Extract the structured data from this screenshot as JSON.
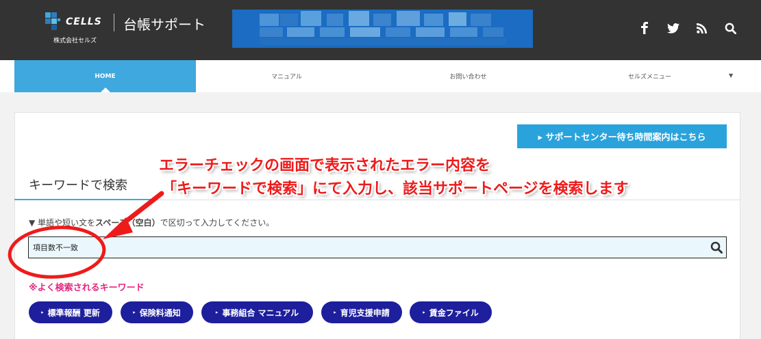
{
  "header": {
    "logo_text": "CELLS",
    "company_name": "株式会社セルズ",
    "site_title": "台帳サポート",
    "social": [
      {
        "icon": "facebook-icon"
      },
      {
        "icon": "twitter-icon"
      },
      {
        "icon": "rss-icon"
      },
      {
        "icon": "search-icon"
      }
    ]
  },
  "nav": {
    "items": [
      {
        "label": "HOME",
        "active": true
      },
      {
        "label": "マニュアル"
      },
      {
        "label": "お問い合わせ"
      },
      {
        "label": "セルズメニュー",
        "has_dropdown": true
      }
    ],
    "dropdown_glyph": "▼"
  },
  "support_button": {
    "label": "▸ サポートセンター待ち時間案内はこちら"
  },
  "search_section": {
    "title": "キーワードで検索",
    "hint_before": "▼ 単語や短い文を",
    "hint_bold": "スペース（空白）",
    "hint_after": "で区切って入力してください。",
    "input_value": "項目数不一致",
    "popular_label": "※よく検索されるキーワード",
    "tags": [
      "標準報酬 更新",
      "保険料通知",
      "事務組合 マニュアル",
      "育児支援申請",
      "賃金ファイル"
    ],
    "tag_glyph": "▸"
  },
  "annotation": {
    "line1": "エラーチェックの画面で表示されたエラー内容を",
    "line2": "「キーワードで検索」にて入力し、該当サポートページを検索します",
    "color": "#ee1b1b"
  },
  "colors": {
    "header_bg": "#333333",
    "accent": "#3fa8de",
    "tag_bg": "#1d1f9c",
    "popular_text": "#e2267f",
    "search_bg": "#eaf7fd"
  }
}
